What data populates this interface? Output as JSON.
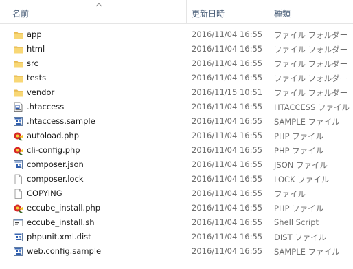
{
  "columns": {
    "name": "名前",
    "date": "更新日時",
    "type": "種類"
  },
  "files": [
    {
      "name": "app",
      "date": "2016/11/04 16:55",
      "type": "ファイル フォルダー",
      "icon": "folder-icon"
    },
    {
      "name": "html",
      "date": "2016/11/04 16:55",
      "type": "ファイル フォルダー",
      "icon": "folder-icon"
    },
    {
      "name": "src",
      "date": "2016/11/04 16:55",
      "type": "ファイル フォルダー",
      "icon": "folder-icon"
    },
    {
      "name": "tests",
      "date": "2016/11/04 16:55",
      "type": "ファイル フォルダー",
      "icon": "folder-icon"
    },
    {
      "name": "vendor",
      "date": "2016/11/15 10:51",
      "type": "ファイル フォルダー",
      "icon": "folder-icon"
    },
    {
      "name": ".htaccess",
      "date": "2016/11/04 16:55",
      "type": "HTACCESS ファイル",
      "icon": "htaccess-file-icon"
    },
    {
      "name": ".htaccess.sample",
      "date": "2016/11/04 16:55",
      "type": "SAMPLE ファイル",
      "icon": "generic-app-file-icon"
    },
    {
      "name": "autoload.php",
      "date": "2016/11/04 16:55",
      "type": "PHP ファイル",
      "icon": "php-file-icon"
    },
    {
      "name": "cli-config.php",
      "date": "2016/11/04 16:55",
      "type": "PHP ファイル",
      "icon": "php-file-icon"
    },
    {
      "name": "composer.json",
      "date": "2016/11/04 16:55",
      "type": "JSON ファイル",
      "icon": "generic-app-file-icon"
    },
    {
      "name": "composer.lock",
      "date": "2016/11/04 16:55",
      "type": "LOCK ファイル",
      "icon": "blank-file-icon"
    },
    {
      "name": "COPYING",
      "date": "2016/11/04 16:55",
      "type": "ファイル",
      "icon": "blank-file-icon"
    },
    {
      "name": "eccube_install.php",
      "date": "2016/11/04 16:55",
      "type": "PHP ファイル",
      "icon": "php-file-icon"
    },
    {
      "name": "eccube_install.sh",
      "date": "2016/11/04 16:55",
      "type": "Shell Script",
      "icon": "shell-script-icon"
    },
    {
      "name": "phpunit.xml.dist",
      "date": "2016/11/04 16:55",
      "type": "DIST ファイル",
      "icon": "generic-app-file-icon"
    },
    {
      "name": "web.config.sample",
      "date": "2016/11/04 16:55",
      "type": "SAMPLE ファイル",
      "icon": "generic-app-file-icon"
    }
  ]
}
